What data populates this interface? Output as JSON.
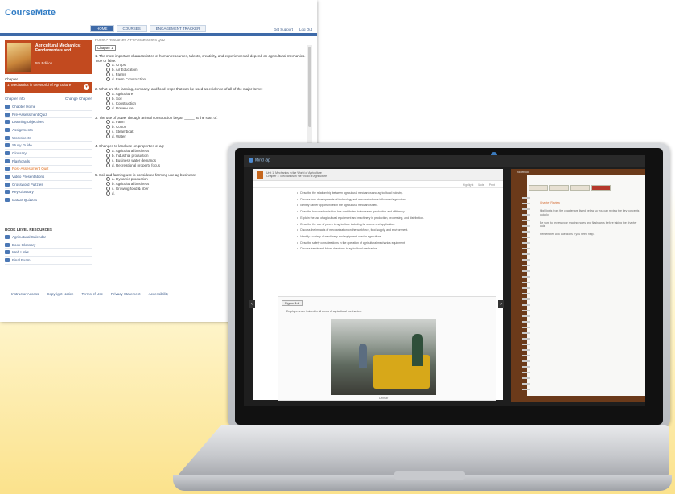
{
  "coursemate": {
    "logo_main": "Course",
    "logo_accent": "Mate",
    "tabs": [
      "HOME",
      "COURSES",
      "ENGAGEMENT TRACKER"
    ],
    "top_links": [
      "Get Support",
      "Log Out"
    ],
    "breadcrumb": "Home > Resources > Pre-Assessment Quiz",
    "book_title": "Agricultural Mechanics: Fundamentals and",
    "book_edition": "5th Edition",
    "chapter_label": "Chapter",
    "chapter_value": "1: Mechanics in the World of Agriculture",
    "side_links": [
      "Chapter Info",
      "Change Chapter"
    ],
    "nav_items": [
      "Chapter Home",
      "Pre-Assessment Quiz",
      "Learning Objectives",
      "Assignments",
      "Worksheets",
      "Study Guide",
      "Glossary",
      "Flashcards",
      "Post-Assessment Quiz",
      "Video Presentations",
      "Crossword Puzzles",
      "Key Glossary",
      "Instant Quizzes"
    ],
    "nav_highlight_index": 8,
    "nav2_heading": "BOOK LEVEL RESOURCES",
    "nav2_items": [
      "Agricultural Calendar",
      "Book Glossary",
      "Web Links",
      "Final Exam"
    ],
    "footer_links": [
      "Instructor Access",
      "Copyright Notice",
      "Terms of Use",
      "Privacy Statement",
      "Accessibility"
    ],
    "quiz_heading": "Chapter 1",
    "questions": [
      {
        "text": "1. The most important characteristics of human resources, talents, creativity, and experiences all depend on agricultural mechanics. True or false:",
        "options": [
          "a. Crops",
          "b. Air Education",
          "c. Farms",
          "d. Farm Construction"
        ]
      },
      {
        "text": "2. What are the farming, company, and food crops that can be used as evidence of all of the major items:",
        "options": [
          "a. Agriculture",
          "b. Soil",
          "c. Construction",
          "d. Power-use"
        ]
      },
      {
        "text": "3. The use of power through animal construction began _____ at the start of:",
        "options": [
          "a. Farm",
          "b. Cotton",
          "c. Steamboat",
          "d. Water"
        ]
      },
      {
        "text": "4. Changes to land use on properties of ag:",
        "options": [
          "a. Agricultural business",
          "b. Industrial production",
          "c. Business water demands",
          "d. Recreational property focus"
        ]
      },
      {
        "text": "5. Soil and farming use is considered farming use ag business:",
        "options": [
          "a. Dynamic production",
          "b. Agricultural business",
          "c. Growing food & fiber",
          "d."
        ]
      }
    ]
  },
  "mindtap": {
    "app_name": "MindTap",
    "reader_title": "Unit 1: Mechanics in the World of Agriculture",
    "reader_subtitle": "Chapter 1: Mechanics in the World of Agriculture",
    "tools": [
      "Highlight",
      "Note",
      "Print"
    ],
    "bullets": [
      "Describe the relationship between agricultural mechanics and agricultural industry.",
      "Discuss how developments of technology and mechanics have influenced agriculture.",
      "Identify career opportunities in the agricultural mechanics field.",
      "Describe how mechanization has contributed to increased production and efficiency.",
      "Explain the use of agricultural equipment and machinery in production, processing, and distribution.",
      "Describe the use of power in agriculture including its source and application.",
      "Discuss the impacts of mechanization on the workforce, food supply, and environment.",
      "Identify a variety of machinery and equipment used in agriculture.",
      "Describe safety considerations in the operation of agricultural mechanics equipment.",
      "Discuss trends and future directions in agricultural mechanics."
    ],
    "figure_tab": "Figure 1-1",
    "figure_caption": "Employees are trained in all areas of agricultural mechanics.",
    "figure_credit": "Delmar",
    "notebook_header": "Notebook",
    "notebook_heading": "Chapter Review",
    "notebook_paras": [
      "Highlights from the chapter are listed below so you can review the key concepts quickly.",
      "Be sure to review your reading notes and flashcards before taking the chapter quiz.",
      "Remember: Ask questions if you need help."
    ]
  }
}
